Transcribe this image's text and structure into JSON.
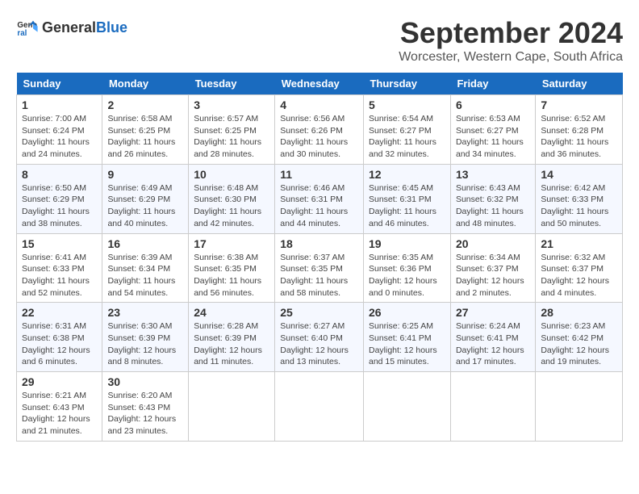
{
  "header": {
    "logo_general": "General",
    "logo_blue": "Blue",
    "month_title": "September 2024",
    "location": "Worcester, Western Cape, South Africa"
  },
  "days_of_week": [
    "Sunday",
    "Monday",
    "Tuesday",
    "Wednesday",
    "Thursday",
    "Friday",
    "Saturday"
  ],
  "weeks": [
    [
      {
        "day": "1",
        "sunrise": "7:00 AM",
        "sunset": "6:24 PM",
        "daylight": "11 hours and 24 minutes."
      },
      {
        "day": "2",
        "sunrise": "6:58 AM",
        "sunset": "6:25 PM",
        "daylight": "11 hours and 26 minutes."
      },
      {
        "day": "3",
        "sunrise": "6:57 AM",
        "sunset": "6:25 PM",
        "daylight": "11 hours and 28 minutes."
      },
      {
        "day": "4",
        "sunrise": "6:56 AM",
        "sunset": "6:26 PM",
        "daylight": "11 hours and 30 minutes."
      },
      {
        "day": "5",
        "sunrise": "6:54 AM",
        "sunset": "6:27 PM",
        "daylight": "11 hours and 32 minutes."
      },
      {
        "day": "6",
        "sunrise": "6:53 AM",
        "sunset": "6:27 PM",
        "daylight": "11 hours and 34 minutes."
      },
      {
        "day": "7",
        "sunrise": "6:52 AM",
        "sunset": "6:28 PM",
        "daylight": "11 hours and 36 minutes."
      }
    ],
    [
      {
        "day": "8",
        "sunrise": "6:50 AM",
        "sunset": "6:29 PM",
        "daylight": "11 hours and 38 minutes."
      },
      {
        "day": "9",
        "sunrise": "6:49 AM",
        "sunset": "6:29 PM",
        "daylight": "11 hours and 40 minutes."
      },
      {
        "day": "10",
        "sunrise": "6:48 AM",
        "sunset": "6:30 PM",
        "daylight": "11 hours and 42 minutes."
      },
      {
        "day": "11",
        "sunrise": "6:46 AM",
        "sunset": "6:31 PM",
        "daylight": "11 hours and 44 minutes."
      },
      {
        "day": "12",
        "sunrise": "6:45 AM",
        "sunset": "6:31 PM",
        "daylight": "11 hours and 46 minutes."
      },
      {
        "day": "13",
        "sunrise": "6:43 AM",
        "sunset": "6:32 PM",
        "daylight": "11 hours and 48 minutes."
      },
      {
        "day": "14",
        "sunrise": "6:42 AM",
        "sunset": "6:33 PM",
        "daylight": "11 hours and 50 minutes."
      }
    ],
    [
      {
        "day": "15",
        "sunrise": "6:41 AM",
        "sunset": "6:33 PM",
        "daylight": "11 hours and 52 minutes."
      },
      {
        "day": "16",
        "sunrise": "6:39 AM",
        "sunset": "6:34 PM",
        "daylight": "11 hours and 54 minutes."
      },
      {
        "day": "17",
        "sunrise": "6:38 AM",
        "sunset": "6:35 PM",
        "daylight": "11 hours and 56 minutes."
      },
      {
        "day": "18",
        "sunrise": "6:37 AM",
        "sunset": "6:35 PM",
        "daylight": "11 hours and 58 minutes."
      },
      {
        "day": "19",
        "sunrise": "6:35 AM",
        "sunset": "6:36 PM",
        "daylight": "12 hours and 0 minutes."
      },
      {
        "day": "20",
        "sunrise": "6:34 AM",
        "sunset": "6:37 PM",
        "daylight": "12 hours and 2 minutes."
      },
      {
        "day": "21",
        "sunrise": "6:32 AM",
        "sunset": "6:37 PM",
        "daylight": "12 hours and 4 minutes."
      }
    ],
    [
      {
        "day": "22",
        "sunrise": "6:31 AM",
        "sunset": "6:38 PM",
        "daylight": "12 hours and 6 minutes."
      },
      {
        "day": "23",
        "sunrise": "6:30 AM",
        "sunset": "6:39 PM",
        "daylight": "12 hours and 8 minutes."
      },
      {
        "day": "24",
        "sunrise": "6:28 AM",
        "sunset": "6:39 PM",
        "daylight": "12 hours and 11 minutes."
      },
      {
        "day": "25",
        "sunrise": "6:27 AM",
        "sunset": "6:40 PM",
        "daylight": "12 hours and 13 minutes."
      },
      {
        "day": "26",
        "sunrise": "6:25 AM",
        "sunset": "6:41 PM",
        "daylight": "12 hours and 15 minutes."
      },
      {
        "day": "27",
        "sunrise": "6:24 AM",
        "sunset": "6:41 PM",
        "daylight": "12 hours and 17 minutes."
      },
      {
        "day": "28",
        "sunrise": "6:23 AM",
        "sunset": "6:42 PM",
        "daylight": "12 hours and 19 minutes."
      }
    ],
    [
      {
        "day": "29",
        "sunrise": "6:21 AM",
        "sunset": "6:43 PM",
        "daylight": "12 hours and 21 minutes."
      },
      {
        "day": "30",
        "sunrise": "6:20 AM",
        "sunset": "6:43 PM",
        "daylight": "12 hours and 23 minutes."
      },
      null,
      null,
      null,
      null,
      null
    ]
  ]
}
